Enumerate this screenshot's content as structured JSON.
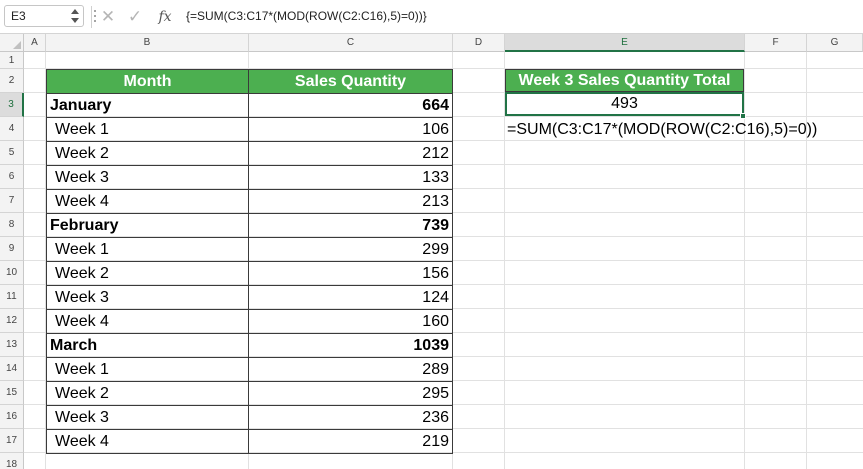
{
  "formula_bar": {
    "name_box": "E3",
    "cancel_icon": "✕",
    "enter_icon": "✓",
    "fx_label": "fx",
    "formula": "{=SUM(C3:C17*(MOD(ROW(C2:C16),5)=0))}"
  },
  "columns": [
    "A",
    "B",
    "C",
    "D",
    "E",
    "F",
    "G"
  ],
  "rows": [
    "1",
    "2",
    "3",
    "4",
    "5",
    "6",
    "7",
    "8",
    "9",
    "10",
    "11",
    "12",
    "13",
    "14",
    "15",
    "16",
    "17",
    "18"
  ],
  "active_cell": {
    "column": "E",
    "row": "3"
  },
  "table": {
    "headers": {
      "month": "Month",
      "sales": "Sales Quantity"
    },
    "rows": [
      {
        "label": "January",
        "value": "664",
        "type": "month"
      },
      {
        "label": "Week 1",
        "value": "106",
        "type": "week"
      },
      {
        "label": "Week 2",
        "value": "212",
        "type": "week"
      },
      {
        "label": "Week 3",
        "value": "133",
        "type": "week"
      },
      {
        "label": "Week 4",
        "value": "213",
        "type": "week"
      },
      {
        "label": "February",
        "value": "739",
        "type": "month"
      },
      {
        "label": "Week 1",
        "value": "299",
        "type": "week"
      },
      {
        "label": "Week 2",
        "value": "156",
        "type": "week"
      },
      {
        "label": "Week 3",
        "value": "124",
        "type": "week"
      },
      {
        "label": "Week 4",
        "value": "160",
        "type": "week"
      },
      {
        "label": "March",
        "value": "1039",
        "type": "month"
      },
      {
        "label": "Week 1",
        "value": "289",
        "type": "week"
      },
      {
        "label": "Week 2",
        "value": "295",
        "type": "week"
      },
      {
        "label": "Week 3",
        "value": "236",
        "type": "week"
      },
      {
        "label": "Week 4",
        "value": "219",
        "type": "week"
      }
    ]
  },
  "result": {
    "header": "Week 3 Sales Quantity Total",
    "value": "493",
    "formula_text": "=SUM(C3:C17*(MOD(ROW(C2:C16),5)=0))"
  },
  "colors": {
    "header_green": "#4caf50",
    "selection_green": "#217346"
  }
}
